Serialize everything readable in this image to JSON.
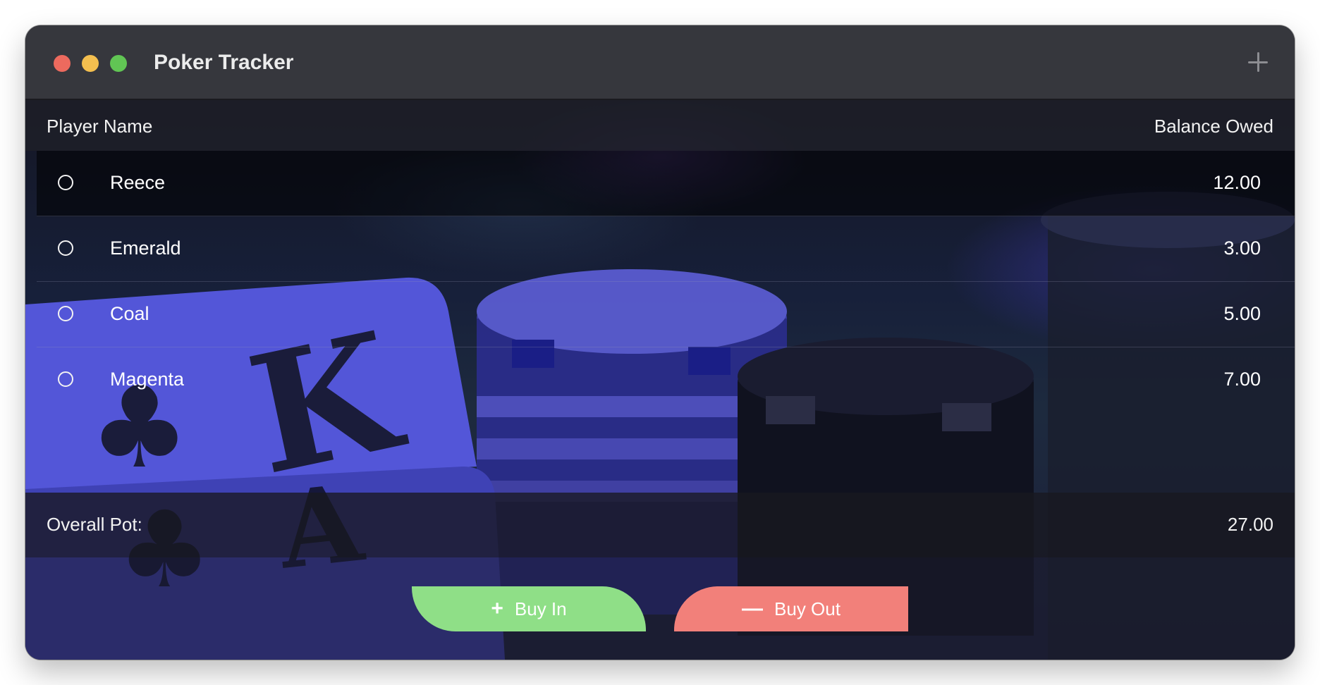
{
  "window": {
    "title": "Poker Tracker"
  },
  "table": {
    "header": {
      "name_col": "Player Name",
      "balance_col": "Balance Owed"
    },
    "players": [
      {
        "name": "Reece",
        "balance": "12.00"
      },
      {
        "name": "Emerald",
        "balance": "3.00"
      },
      {
        "name": "Coal",
        "balance": "5.00"
      },
      {
        "name": "Magenta",
        "balance": "7.00"
      }
    ]
  },
  "pot": {
    "label": "Overall Pot:",
    "value": "27.00"
  },
  "actions": {
    "buy_in": {
      "label": "Buy In",
      "icon": "plus-icon"
    },
    "buy_out": {
      "label": "Buy Out",
      "icon": "minus-icon"
    }
  },
  "colors": {
    "buy_in": "#8fdf87",
    "buy_out": "#f2807a",
    "titlebar": "#36373d"
  }
}
